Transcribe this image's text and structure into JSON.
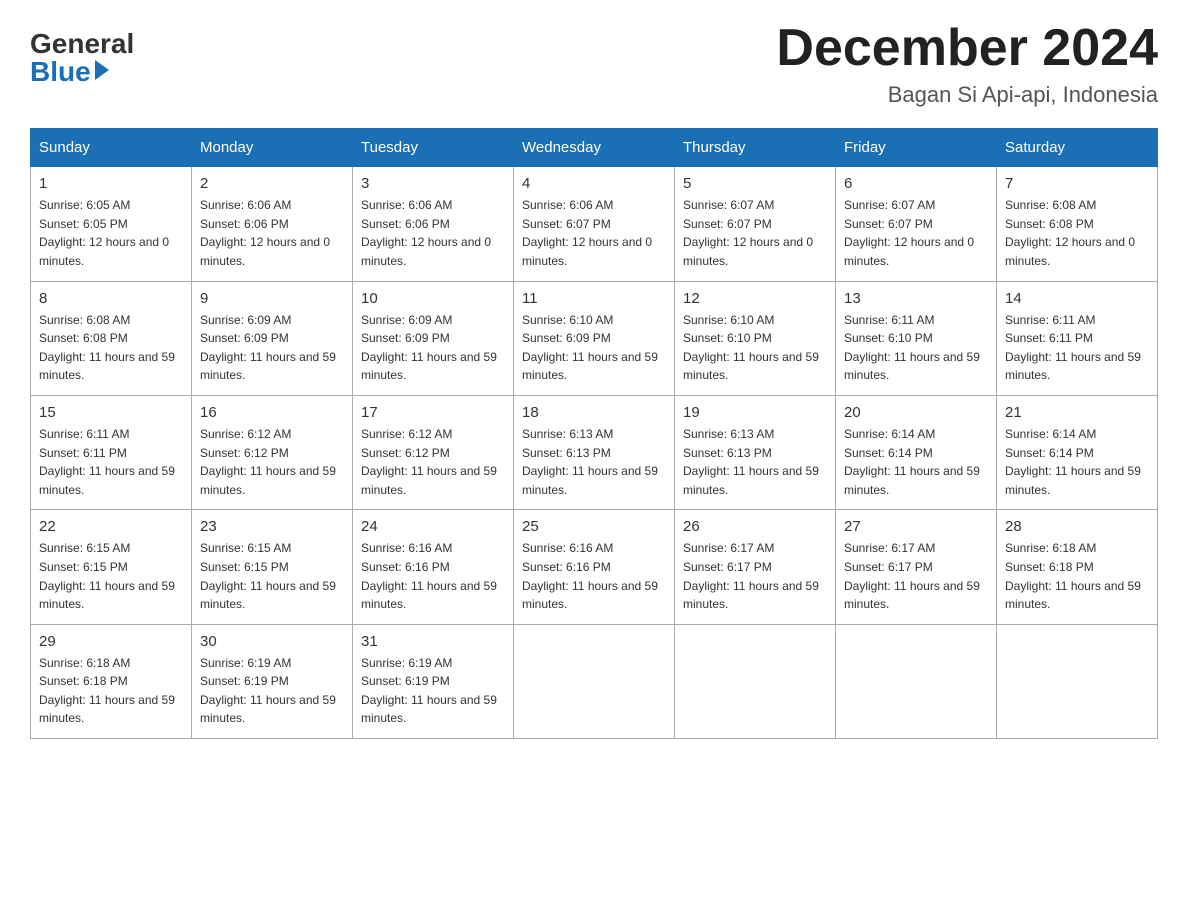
{
  "header": {
    "logo_general": "General",
    "logo_blue": "Blue",
    "month_title": "December 2024",
    "location": "Bagan Si Api-api, Indonesia"
  },
  "calendar": {
    "days_of_week": [
      "Sunday",
      "Monday",
      "Tuesday",
      "Wednesday",
      "Thursday",
      "Friday",
      "Saturday"
    ],
    "weeks": [
      [
        {
          "day": "1",
          "sunrise": "6:05 AM",
          "sunset": "6:05 PM",
          "daylight": "12 hours and 0 minutes."
        },
        {
          "day": "2",
          "sunrise": "6:06 AM",
          "sunset": "6:06 PM",
          "daylight": "12 hours and 0 minutes."
        },
        {
          "day": "3",
          "sunrise": "6:06 AM",
          "sunset": "6:06 PM",
          "daylight": "12 hours and 0 minutes."
        },
        {
          "day": "4",
          "sunrise": "6:06 AM",
          "sunset": "6:07 PM",
          "daylight": "12 hours and 0 minutes."
        },
        {
          "day": "5",
          "sunrise": "6:07 AM",
          "sunset": "6:07 PM",
          "daylight": "12 hours and 0 minutes."
        },
        {
          "day": "6",
          "sunrise": "6:07 AM",
          "sunset": "6:07 PM",
          "daylight": "12 hours and 0 minutes."
        },
        {
          "day": "7",
          "sunrise": "6:08 AM",
          "sunset": "6:08 PM",
          "daylight": "12 hours and 0 minutes."
        }
      ],
      [
        {
          "day": "8",
          "sunrise": "6:08 AM",
          "sunset": "6:08 PM",
          "daylight": "11 hours and 59 minutes."
        },
        {
          "day": "9",
          "sunrise": "6:09 AM",
          "sunset": "6:09 PM",
          "daylight": "11 hours and 59 minutes."
        },
        {
          "day": "10",
          "sunrise": "6:09 AM",
          "sunset": "6:09 PM",
          "daylight": "11 hours and 59 minutes."
        },
        {
          "day": "11",
          "sunrise": "6:10 AM",
          "sunset": "6:09 PM",
          "daylight": "11 hours and 59 minutes."
        },
        {
          "day": "12",
          "sunrise": "6:10 AM",
          "sunset": "6:10 PM",
          "daylight": "11 hours and 59 minutes."
        },
        {
          "day": "13",
          "sunrise": "6:11 AM",
          "sunset": "6:10 PM",
          "daylight": "11 hours and 59 minutes."
        },
        {
          "day": "14",
          "sunrise": "6:11 AM",
          "sunset": "6:11 PM",
          "daylight": "11 hours and 59 minutes."
        }
      ],
      [
        {
          "day": "15",
          "sunrise": "6:11 AM",
          "sunset": "6:11 PM",
          "daylight": "11 hours and 59 minutes."
        },
        {
          "day": "16",
          "sunrise": "6:12 AM",
          "sunset": "6:12 PM",
          "daylight": "11 hours and 59 minutes."
        },
        {
          "day": "17",
          "sunrise": "6:12 AM",
          "sunset": "6:12 PM",
          "daylight": "11 hours and 59 minutes."
        },
        {
          "day": "18",
          "sunrise": "6:13 AM",
          "sunset": "6:13 PM",
          "daylight": "11 hours and 59 minutes."
        },
        {
          "day": "19",
          "sunrise": "6:13 AM",
          "sunset": "6:13 PM",
          "daylight": "11 hours and 59 minutes."
        },
        {
          "day": "20",
          "sunrise": "6:14 AM",
          "sunset": "6:14 PM",
          "daylight": "11 hours and 59 minutes."
        },
        {
          "day": "21",
          "sunrise": "6:14 AM",
          "sunset": "6:14 PM",
          "daylight": "11 hours and 59 minutes."
        }
      ],
      [
        {
          "day": "22",
          "sunrise": "6:15 AM",
          "sunset": "6:15 PM",
          "daylight": "11 hours and 59 minutes."
        },
        {
          "day": "23",
          "sunrise": "6:15 AM",
          "sunset": "6:15 PM",
          "daylight": "11 hours and 59 minutes."
        },
        {
          "day": "24",
          "sunrise": "6:16 AM",
          "sunset": "6:16 PM",
          "daylight": "11 hours and 59 minutes."
        },
        {
          "day": "25",
          "sunrise": "6:16 AM",
          "sunset": "6:16 PM",
          "daylight": "11 hours and 59 minutes."
        },
        {
          "day": "26",
          "sunrise": "6:17 AM",
          "sunset": "6:17 PM",
          "daylight": "11 hours and 59 minutes."
        },
        {
          "day": "27",
          "sunrise": "6:17 AM",
          "sunset": "6:17 PM",
          "daylight": "11 hours and 59 minutes."
        },
        {
          "day": "28",
          "sunrise": "6:18 AM",
          "sunset": "6:18 PM",
          "daylight": "11 hours and 59 minutes."
        }
      ],
      [
        {
          "day": "29",
          "sunrise": "6:18 AM",
          "sunset": "6:18 PM",
          "daylight": "11 hours and 59 minutes."
        },
        {
          "day": "30",
          "sunrise": "6:19 AM",
          "sunset": "6:19 PM",
          "daylight": "11 hours and 59 minutes."
        },
        {
          "day": "31",
          "sunrise": "6:19 AM",
          "sunset": "6:19 PM",
          "daylight": "11 hours and 59 minutes."
        },
        null,
        null,
        null,
        null
      ]
    ]
  }
}
